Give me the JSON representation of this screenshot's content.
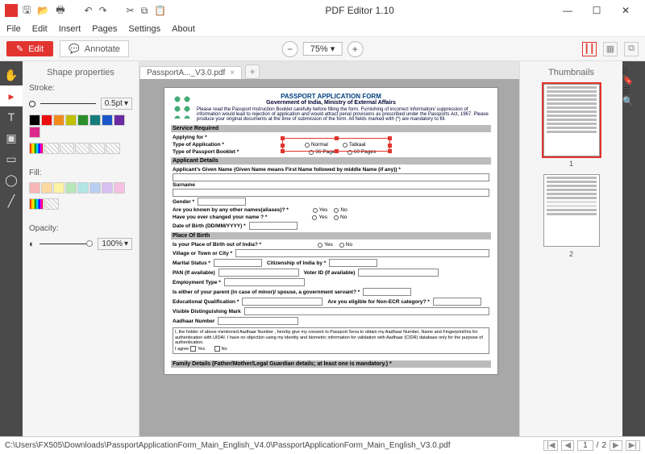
{
  "app": {
    "title": "PDF Editor 1.10"
  },
  "menubar": [
    "File",
    "Edit",
    "Insert",
    "Pages",
    "Settings",
    "About"
  ],
  "toolbar": {
    "edit": "Edit",
    "annotate": "Annotate",
    "zoom": "75%"
  },
  "tabs": {
    "active": "PassportA..._V3.0.pdf"
  },
  "leftpanel": {
    "title": "Shape properties",
    "stroke_label": "Stroke:",
    "stroke_value": "0.5pt",
    "fill_label": "Fill:",
    "opacity_label": "Opacity:",
    "opacity_value": "100%"
  },
  "rightpanel": {
    "title": "Thumbnails",
    "p1": "1",
    "p2": "2"
  },
  "statusbar": {
    "path": "C:\\Users\\FX505\\Downloads\\PassportApplicationForm_Main_English_V4.0\\PassportApplicationForm_Main_English_V3.0.pdf",
    "page_cur": "1",
    "page_sep": "/",
    "page_total": "2"
  },
  "doc": {
    "title": "PASSPORT APPLICATION FORM",
    "subtitle": "Government of India, Ministry of External Affairs",
    "intro": "Please read the Passport Instruction Booklet carefully before filling the form. Furnishing of incorrect information/ suppression of information would lead to rejection of application and would attract penal provisions as prescribed under the Passports Act, 1967. Please produce your original documents at the time of submission of the form. All fields marked with (*) are mandatory to fill.",
    "sec_service": "Service Required",
    "applying_for": "Applying for *",
    "type_app": "Type of Application *",
    "normal": "Normal",
    "tatkaal": "Tatkaal",
    "type_booklet": "Type of Passport Booklet *",
    "p36": "36 Pages",
    "p60": "60 Pages",
    "sec_applicant": "Applicant Details",
    "given_name": "Applicant's Given Name (Given Name means First Name followed by middle Name (if any)) *",
    "surname": "Surname",
    "gender": "Gender *",
    "aliases": "Are you known by any other names(aliases)? *",
    "changed_name": "Have you ever changed your name ? *",
    "yes": "Yes",
    "no": "No",
    "dob": "Date of Birth (DD/MM/YYYY) *",
    "sec_place": "Place Of Birth",
    "pob_out": "Is your Place of Birth out of India? *",
    "village": "Village or Town or City *",
    "marital": "Marital Status *",
    "citizenship": "Citizenship of India by *",
    "pan": "PAN (If available)",
    "voter": "Voter ID (If available)",
    "employment": "Employment Type *",
    "parent_gov": "Is either of your parent (in case of minor)/ spouse, a government servant? *",
    "edu": "Educational Qualification *",
    "nonecr": "Are you eligible for Non-ECR category? *",
    "dist_mark": "Visible Distinguishing Mark",
    "aadhaar": "Aadhaar Number",
    "aadhaar_consent": "I, the holder of above mentioned Aadhaar Number , hereby give my consent to Passport Seva to obtain my Aadhaar Number, Name and Fingerprint/Iris for authentication with UIDAI. I have no objection using my identity and biometric information for validation with Aadhaar (CIDR) database only for the purpose of authentication.",
    "iagree": "I agree",
    "sec_family": "Family Details (Father/Mother/Legal Guardian details; at least one is mandatory.) *"
  },
  "swatches_stroke": [
    "#000000",
    "#ec0e0e",
    "#f08b1d",
    "#c0c000",
    "#2a8f2a",
    "#167b7b",
    "#1a56c7",
    "#6a2aa2",
    "#db2a8a"
  ],
  "swatches_fill": [
    "#f7b6b6",
    "#fcd9a2",
    "#fdf3a2",
    "#b7e6b7",
    "#b0e6e6",
    "#b9cef2",
    "#d7bff2",
    "#f5c0e1"
  ]
}
